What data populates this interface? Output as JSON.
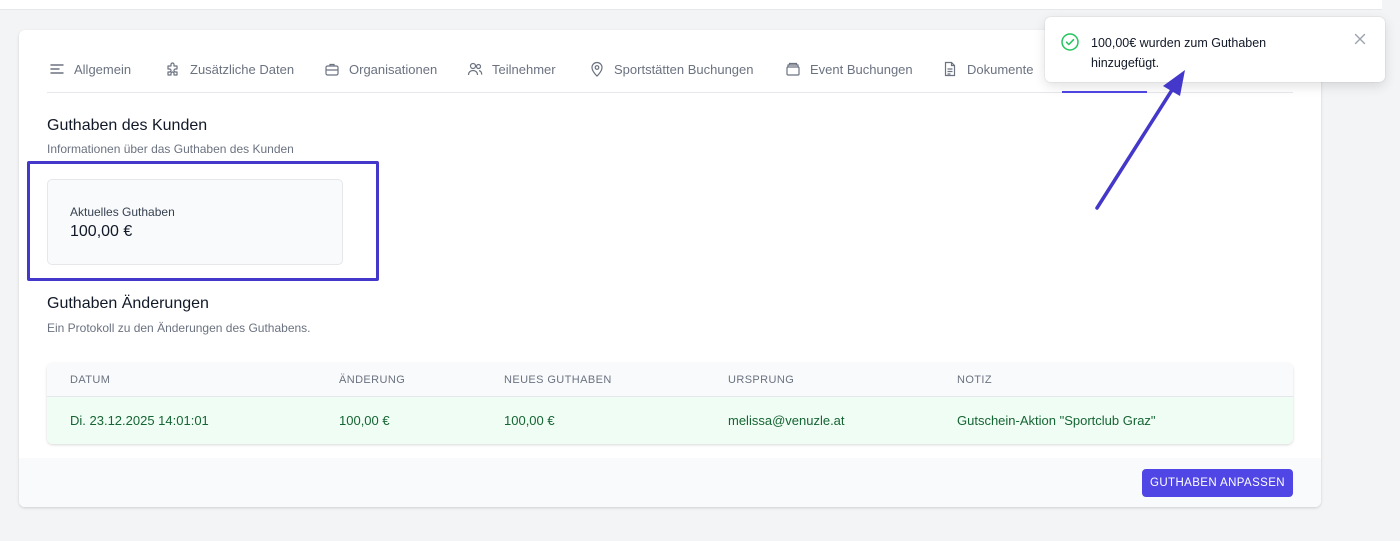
{
  "tabs": [
    {
      "label": "Allgemein",
      "icon": "menu-lines-icon"
    },
    {
      "label": "Zusätzliche Daten",
      "icon": "puzzle-icon"
    },
    {
      "label": "Organisationen",
      "icon": "briefcase-icon"
    },
    {
      "label": "Teilnehmer",
      "icon": "users-icon"
    },
    {
      "label": "Sportstätten Buchungen",
      "icon": "location-pin-icon"
    },
    {
      "label": "Event Buchungen",
      "icon": "box-icon"
    },
    {
      "label": "Dokumente",
      "icon": "document-icon"
    }
  ],
  "balance_section": {
    "title": "Guthaben des Kunden",
    "subtitle": "Informationen über das Guthaben des Kunden",
    "label": "Aktuelles Guthaben",
    "value": "100,00 €"
  },
  "changes_section": {
    "title": "Guthaben Änderungen",
    "subtitle": "Ein Protokoll zu den Änderungen des Guthabens."
  },
  "table": {
    "columns": [
      "DATUM",
      "ÄNDERUNG",
      "NEUES GUTHABEN",
      "URSPRUNG",
      "NOTIZ"
    ],
    "rows": [
      [
        "Di. 23.12.2025 14:01:01",
        "100,00 €",
        "100,00 €",
        "melissa@venuzle.at",
        "Gutschein-Aktion \"Sportclub Graz\""
      ]
    ]
  },
  "footer": {
    "adjust_button_label": "GUTHABEN ANPASSEN"
  },
  "toast": {
    "message": "100,00€ wurden zum Guthaben hinzugefügt.",
    "icon": "check-circle-icon"
  },
  "colors": {
    "accent": "#4f46e5",
    "annotation": "#4338ca",
    "success_text": "#166534",
    "success_bg": "#f0fdf4",
    "success_icon": "#22c55e"
  }
}
